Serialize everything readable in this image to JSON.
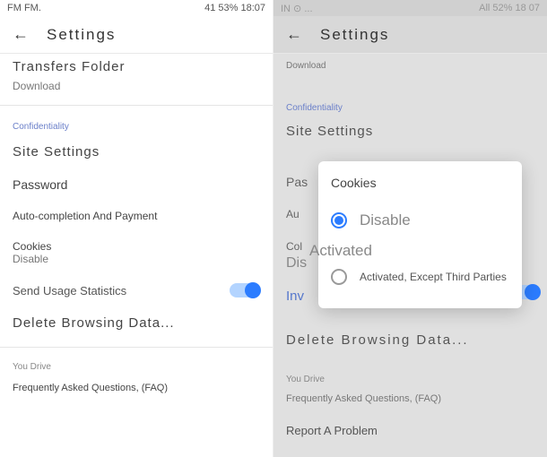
{
  "left": {
    "statusbar": {
      "left": "FM FM.",
      "right": "41 53% 18:07"
    },
    "header_title": "Settings",
    "transfers": {
      "title": "Transfers Folder",
      "value": "Download"
    },
    "confidentiality_label": "Confidentiality",
    "site_settings": "Site Settings",
    "password": "Password",
    "auto_complete": "Auto-completion And Payment",
    "cookies": {
      "label": "Cookies",
      "value": "Disable"
    },
    "send_stats": "Send Usage Statistics",
    "delete_browsing": "Delete Browsing Data...",
    "you_drive": "You Drive",
    "faq": "Frequently Asked Questions, (FAQ)"
  },
  "right": {
    "statusbar": {
      "left": "IN ⊙ ...",
      "right": "All 52% 18  07"
    },
    "header_title": "Settings",
    "download": "Download",
    "confidentiality_label": "Confidentiality",
    "site_settings": "Site Settings",
    "pas": "Pas",
    "au": "Au",
    "col": "Col",
    "dis": "Dis",
    "inv": "Inv",
    "delete_browsing": "Delete Browsing Data...",
    "you_drive": "You Drive",
    "faq": "Frequently Asked Questions, (FAQ)",
    "report": "Report A Problem",
    "modal": {
      "title": "Cookies",
      "opt1": "Disable",
      "opt2": "Activated",
      "opt3": "Activated, Except Third Parties"
    }
  }
}
